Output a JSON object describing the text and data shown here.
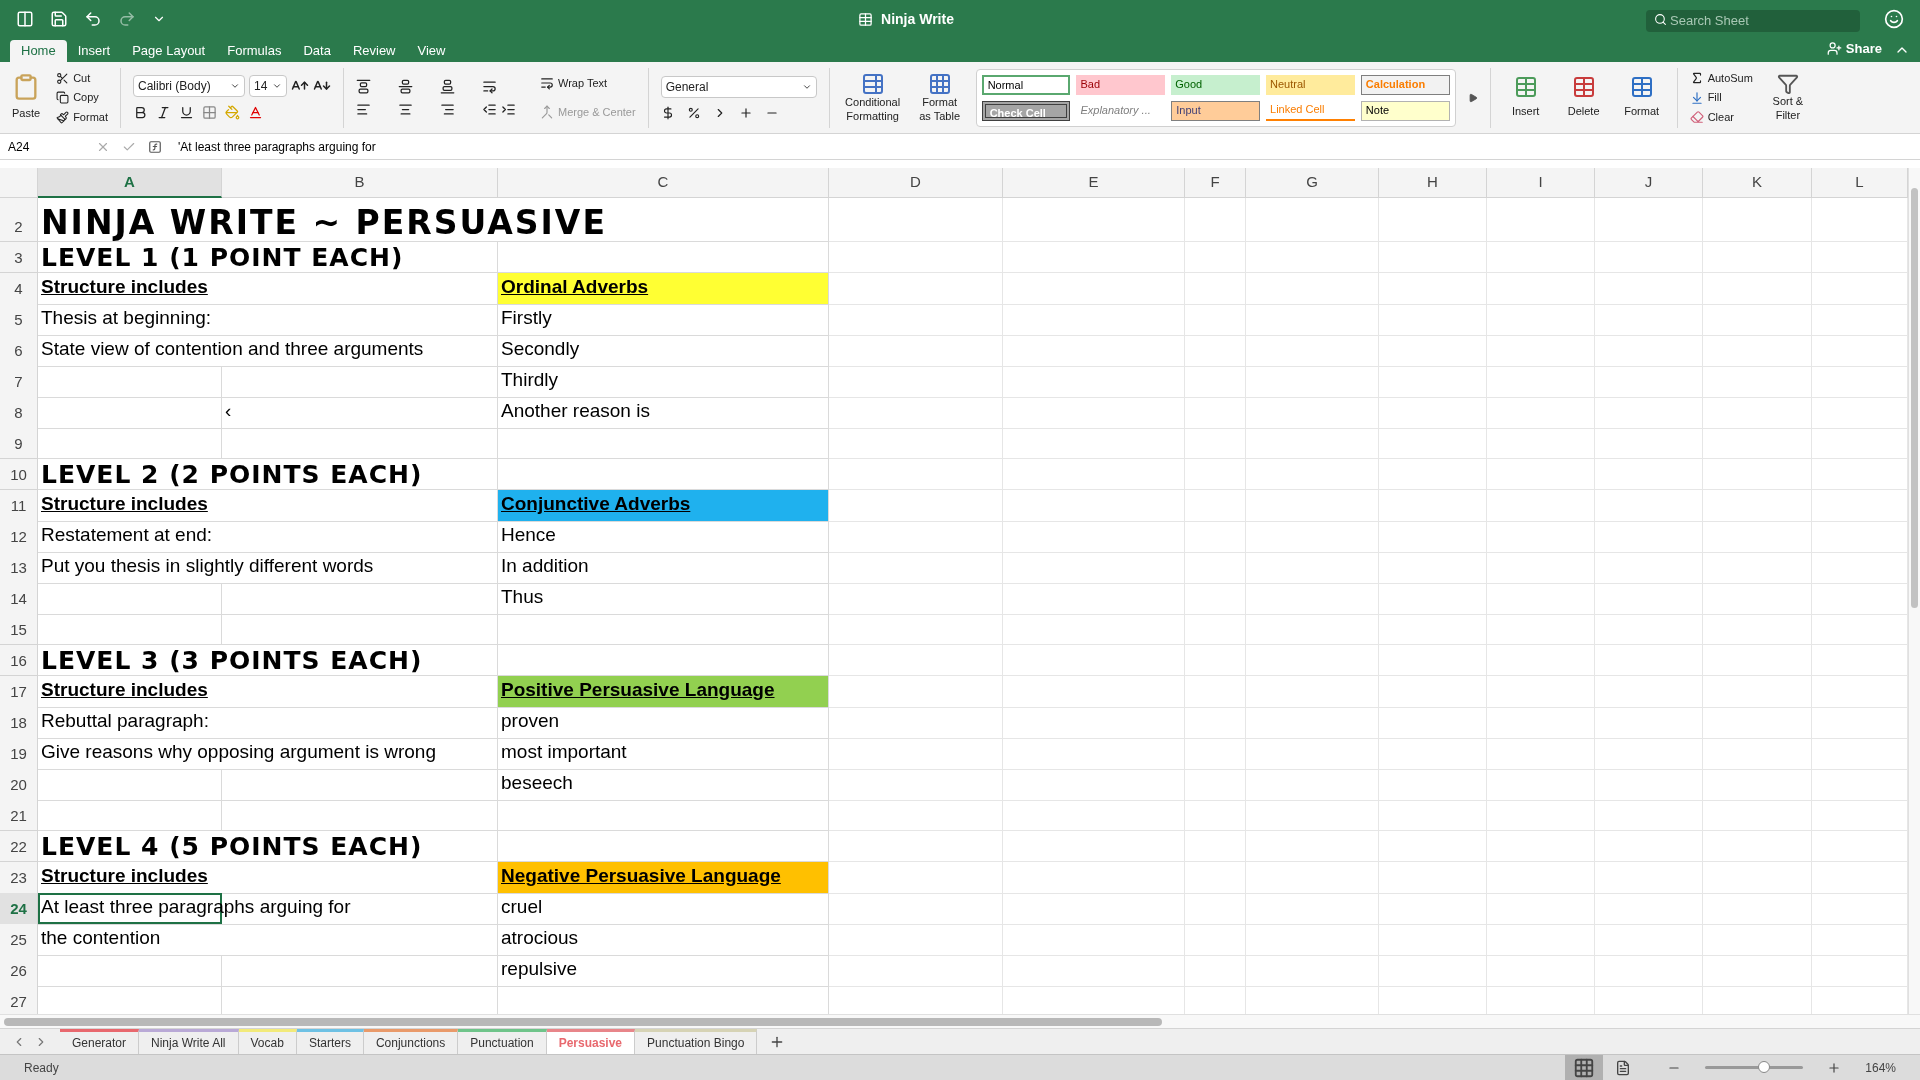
{
  "window": {
    "title": "Ninja Write"
  },
  "search": {
    "placeholder": "Search Sheet"
  },
  "share": {
    "label": "Share"
  },
  "ribbon_tabs": [
    {
      "label": "Home",
      "selected": true
    },
    {
      "label": "Insert",
      "selected": false
    },
    {
      "label": "Page Layout",
      "selected": false
    },
    {
      "label": "Formulas",
      "selected": false
    },
    {
      "label": "Data",
      "selected": false
    },
    {
      "label": "Review",
      "selected": false
    },
    {
      "label": "View",
      "selected": false
    }
  ],
  "clipboard": {
    "paste": "Paste",
    "cut": "Cut",
    "copy": "Copy",
    "format": "Format"
  },
  "font": {
    "name": "Calibri (Body)",
    "size": "14"
  },
  "alignment": {
    "wrap": "Wrap Text",
    "merge": "Merge & Center"
  },
  "number": {
    "format": "General"
  },
  "table_tools": {
    "conditional": "Conditional Formatting",
    "format_table": "Format as Table"
  },
  "styles": [
    {
      "label": "Normal",
      "kind": "normal"
    },
    {
      "label": "Bad",
      "kind": "bad"
    },
    {
      "label": "Good",
      "kind": "good"
    },
    {
      "label": "Neutral",
      "kind": "neutral"
    },
    {
      "label": "Calculation",
      "kind": "calculation"
    },
    {
      "label": "Check Cell",
      "kind": "check"
    },
    {
      "label": "Explanatory ...",
      "kind": "explanatory"
    },
    {
      "label": "Input",
      "kind": "input"
    },
    {
      "label": "Linked Cell",
      "kind": "linked"
    },
    {
      "label": "Note",
      "kind": "note"
    }
  ],
  "cells_group": [
    {
      "label": "Insert",
      "kind": "insert"
    },
    {
      "label": "Delete",
      "kind": "delete"
    },
    {
      "label": "Format",
      "kind": "format"
    }
  ],
  "editing": [
    {
      "label": "AutoSum",
      "kind": "sum"
    },
    {
      "label": "Fill",
      "kind": "fill"
    },
    {
      "label": "Clear",
      "kind": "clear"
    }
  ],
  "sort_filter": {
    "label": "Sort & Filter"
  },
  "formula_bar": {
    "cell_ref": "A24",
    "formula": "'At least three paragraphs arguing for"
  },
  "columns": [
    {
      "label": "A",
      "selected": true
    },
    {
      "label": "B",
      "selected": false
    },
    {
      "label": "C",
      "selected": false
    },
    {
      "label": "D",
      "selected": false
    },
    {
      "label": "E",
      "selected": false
    },
    {
      "label": "F",
      "selected": false
    },
    {
      "label": "G",
      "selected": false
    },
    {
      "label": "H",
      "selected": false
    },
    {
      "label": "I",
      "selected": false
    },
    {
      "label": "J",
      "selected": false
    },
    {
      "label": "K",
      "selected": false
    },
    {
      "label": "L",
      "selected": false
    }
  ],
  "rows": [
    {
      "num": "2",
      "selected": false,
      "a": {
        "text": "NINJA WRITE ~ PERSUASIVE",
        "kind": "title"
      }
    },
    {
      "num": "3",
      "selected": false,
      "a": {
        "text": "LEVEL 1 (1 POINT EACH)",
        "kind": "level"
      }
    },
    {
      "num": "4",
      "selected": false,
      "a": {
        "text": "Structure includes",
        "kind": "heading"
      },
      "c": {
        "text": "Ordinal Adverbs",
        "kind": "heading",
        "color": "#ffff33"
      }
    },
    {
      "num": "5",
      "selected": false,
      "a": {
        "text": "Thesis at beginning:",
        "kind": "plain"
      },
      "c": {
        "text": "Firstly",
        "kind": "plain"
      }
    },
    {
      "num": "6",
      "selected": false,
      "a": {
        "text": "State view of contention and three arguments",
        "kind": "plain"
      },
      "c": {
        "text": "Secondly",
        "kind": "plain"
      }
    },
    {
      "num": "7",
      "selected": false,
      "c": {
        "text": "Thirdly",
        "kind": "plain"
      }
    },
    {
      "num": "8",
      "selected": false,
      "b": {
        "text": "‹",
        "kind": "plain"
      },
      "c": {
        "text": "Another reason is",
        "kind": "plain"
      }
    },
    {
      "num": "9",
      "selected": false
    },
    {
      "num": "10",
      "selected": false,
      "a": {
        "text": "LEVEL 2 (2 POINTS EACH)",
        "kind": "level"
      }
    },
    {
      "num": "11",
      "selected": false,
      "a": {
        "text": "Structure includes",
        "kind": "heading"
      },
      "c": {
        "text": "Conjunctive Adverbs",
        "kind": "heading",
        "color": "#1fb1ee"
      }
    },
    {
      "num": "12",
      "selected": false,
      "a": {
        "text": "Restatement at end:",
        "kind": "plain"
      },
      "c": {
        "text": "Hence",
        "kind": "plain"
      }
    },
    {
      "num": "13",
      "selected": false,
      "a": {
        "text": "Put you thesis in slightly different words",
        "kind": "plain"
      },
      "c": {
        "text": "In addition",
        "kind": "plain"
      }
    },
    {
      "num": "14",
      "selected": false,
      "c": {
        "text": "Thus",
        "kind": "plain"
      }
    },
    {
      "num": "15",
      "selected": false
    },
    {
      "num": "16",
      "selected": false,
      "a": {
        "text": "LEVEL 3 (3 POINTS EACH)",
        "kind": "level"
      }
    },
    {
      "num": "17",
      "selected": false,
      "a": {
        "text": "Structure includes",
        "kind": "heading"
      },
      "c": {
        "text": "Positive Persuasive Language",
        "kind": "heading",
        "color": "#92d050"
      }
    },
    {
      "num": "18",
      "selected": false,
      "a": {
        "text": "Rebuttal paragraph:",
        "kind": "plain"
      },
      "c": {
        "text": "proven",
        "kind": "plain"
      }
    },
    {
      "num": "19",
      "selected": false,
      "a": {
        "text": "Give reasons why opposing argument is wrong",
        "kind": "plain"
      },
      "c": {
        "text": "most important",
        "kind": "plain"
      }
    },
    {
      "num": "20",
      "selected": false,
      "c": {
        "text": "beseech",
        "kind": "plain"
      }
    },
    {
      "num": "21",
      "selected": false
    },
    {
      "num": "22",
      "selected": false,
      "a": {
        "text": "LEVEL 4 (5 POINTS EACH)",
        "kind": "level"
      }
    },
    {
      "num": "23",
      "selected": false,
      "a": {
        "text": "Structure includes",
        "kind": "heading"
      },
      "c": {
        "text": "Negative Persuasive Language",
        "kind": "heading",
        "color": "#ffc000"
      }
    },
    {
      "num": "24",
      "selected": true,
      "a": {
        "text": "At least three paragraphs arguing for",
        "kind": "plain"
      },
      "c": {
        "text": "cruel",
        "kind": "plain"
      }
    },
    {
      "num": "25",
      "selected": false,
      "a": {
        "text": "the contention",
        "kind": "plain"
      },
      "c": {
        "text": "atrocious",
        "kind": "plain"
      }
    },
    {
      "num": "26",
      "selected": false,
      "c": {
        "text": "repulsive",
        "kind": "plain"
      }
    },
    {
      "num": "27",
      "selected": false
    }
  ],
  "sheet_tabs": [
    {
      "label": "Generator",
      "color": "#e8686e",
      "selected": false
    },
    {
      "label": "Ninja Write All",
      "color": "#b9a9d6",
      "selected": false
    },
    {
      "label": "Vocab",
      "color": "#f2ea7a",
      "selected": false
    },
    {
      "label": "Starters",
      "color": "#6ec1e4",
      "selected": false
    },
    {
      "label": "Conjunctions",
      "color": "#e99a6a",
      "selected": false
    },
    {
      "label": "Punctuation",
      "color": "#6fc48a",
      "selected": false
    },
    {
      "label": "Persuasive",
      "color": "#e8868a",
      "selected": true
    },
    {
      "label": "Punctuation Bingo",
      "color": "#d6d3b5",
      "selected": false
    }
  ],
  "status_bar": {
    "status": "Ready",
    "zoom": "164%",
    "zoom_level": {
      "level": 0.6
    }
  }
}
